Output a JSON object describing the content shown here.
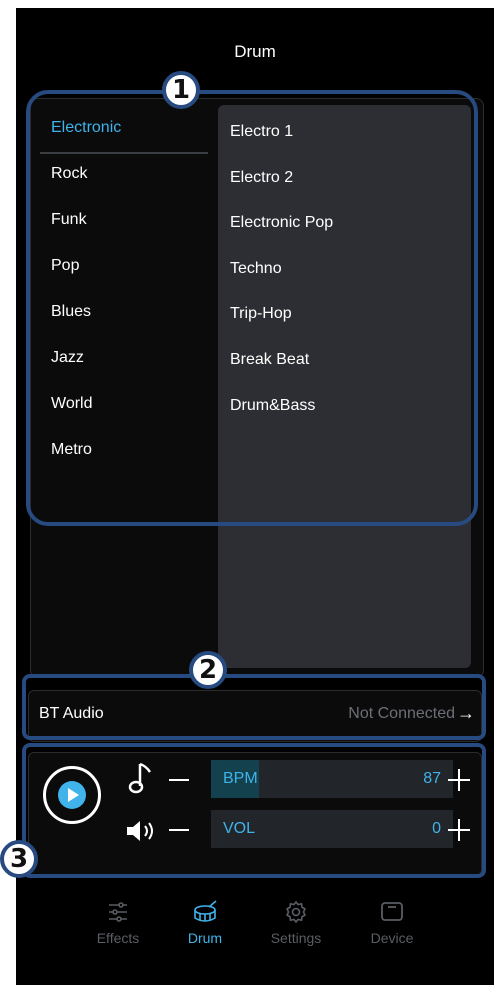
{
  "header": {
    "title": "Drum"
  },
  "styles": [
    "Electronic",
    "Rock",
    "Funk",
    "Pop",
    "Blues",
    "Jazz",
    "World",
    "Metro"
  ],
  "selected_style": "Electronic",
  "presets": [
    "Electro 1",
    "Electro 2",
    "Electronic Pop",
    "Techno",
    "Trip-Hop",
    "Break Beat",
    "Drum&Bass"
  ],
  "bluetooth": {
    "label": "BT Audio",
    "status": "Not Connected",
    "arrow": "→"
  },
  "controls": {
    "play_icon": "play-icon",
    "bpm": {
      "label": "BPM",
      "value": "87",
      "level_fraction": 0.2,
      "icon": "music-note-icon"
    },
    "vol": {
      "label": "VOL",
      "value": "0",
      "level_fraction": 0.0,
      "icon": "speaker-icon"
    }
  },
  "annotations": {
    "badge1": "1",
    "badge2": "2",
    "badge3": "3"
  },
  "tabs": [
    {
      "label": "Effects",
      "icon": "sliders-icon",
      "active": false
    },
    {
      "label": "Drum",
      "icon": "drum-icon",
      "active": true
    },
    {
      "label": "Settings",
      "icon": "gear-icon",
      "active": false
    },
    {
      "label": "Device",
      "icon": "device-icon",
      "active": false
    }
  ],
  "colors": {
    "accent": "#3fb3ea",
    "highlight_border": "#274a80",
    "background": "#000000"
  }
}
